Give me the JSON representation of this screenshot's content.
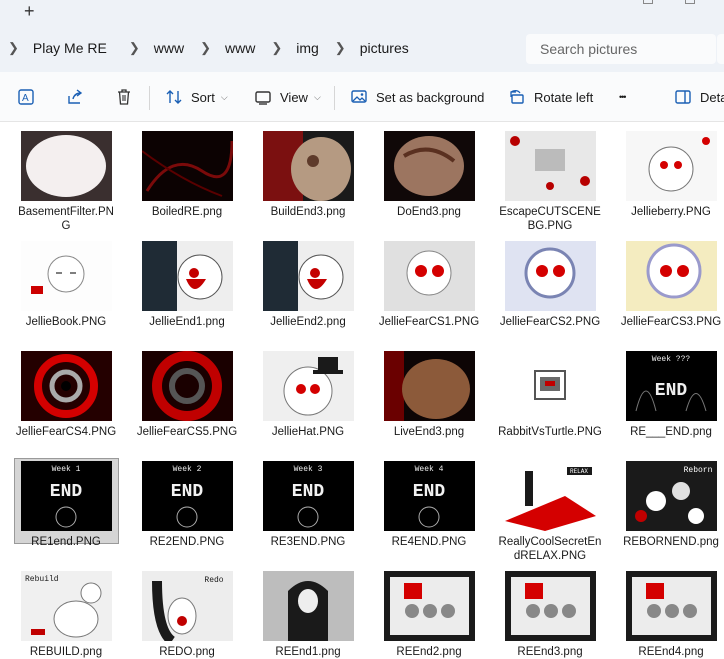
{
  "title_bar": {
    "new_tab_glyph": "+"
  },
  "breadcrumb": {
    "items": [
      "Play Me RE",
      "www",
      "www",
      "img",
      "pictures"
    ]
  },
  "search": {
    "placeholder": "Search pictures"
  },
  "commands": {
    "sort_label": "Sort",
    "view_label": "View",
    "set_background_label": "Set as background",
    "rotate_left_label": "Rotate left",
    "more_label": "•••",
    "details_label": "Details"
  },
  "icons": [
    "expand-icon",
    "share-icon",
    "delete-icon",
    "sort-icon",
    "view-icon",
    "set-background-icon",
    "rotate-left-icon",
    "details-icon",
    "chevron-right-icon",
    "chevron-down-icon"
  ],
  "colors": {
    "accent": "#1a5fb4",
    "selection": "#d5d5d5",
    "red": "#d40000"
  },
  "files": [
    {
      "name": "BasementFilter.PNG",
      "style": "basement"
    },
    {
      "name": "BoiledRE.png",
      "style": "boiled"
    },
    {
      "name": "BuildEnd3.png",
      "style": "build"
    },
    {
      "name": "DoEnd3.png",
      "style": "doend"
    },
    {
      "name": "EscapeCUTSCENEBG.PNG",
      "style": "escape"
    },
    {
      "name": "Jellieberry.PNG",
      "style": "jellieberry"
    },
    {
      "name": "JellieBook.PNG",
      "style": "book"
    },
    {
      "name": "JellieEnd1.png",
      "style": "jend"
    },
    {
      "name": "JellieEnd2.png",
      "style": "jend"
    },
    {
      "name": "JellieFearCS1.PNG",
      "style": "fear"
    },
    {
      "name": "JellieFearCS2.PNG",
      "style": "fear2"
    },
    {
      "name": "JellieFearCS3.PNG",
      "style": "fear3"
    },
    {
      "name": "JellieFearCS4.PNG",
      "style": "swirl"
    },
    {
      "name": "JellieFearCS5.PNG",
      "style": "swirl2"
    },
    {
      "name": "JellieHat.PNG",
      "style": "hat"
    },
    {
      "name": "LiveEnd3.png",
      "style": "live"
    },
    {
      "name": "RabbitVsTurtle.PNG",
      "style": "rabbit"
    },
    {
      "name": "RE___END.png",
      "style": "reend",
      "caption": "Week ???"
    },
    {
      "name": "RE1end.PNG",
      "style": "week",
      "caption": "Week 1",
      "selected": true
    },
    {
      "name": "RE2END.PNG",
      "style": "week",
      "caption": "Week 2"
    },
    {
      "name": "RE3END.PNG",
      "style": "week",
      "caption": "Week 3"
    },
    {
      "name": "RE4END.PNG",
      "style": "week",
      "caption": "Week 4"
    },
    {
      "name": "ReallyCoolSecretEndRELAX.PNG",
      "style": "relax",
      "caption": "RELAX"
    },
    {
      "name": "REBORNEND.png",
      "style": "reborn",
      "caption": "Reborn"
    },
    {
      "name": "REBUILD.png",
      "style": "rebuild",
      "caption": "Rebuild"
    },
    {
      "name": "REDO.png",
      "style": "redo",
      "caption": "Redo"
    },
    {
      "name": "REEnd1.png",
      "style": "reend1"
    },
    {
      "name": "REEnd2.png",
      "style": "framed"
    },
    {
      "name": "REEnd3.png",
      "style": "framed"
    },
    {
      "name": "REEnd4.png",
      "style": "framed"
    }
  ]
}
